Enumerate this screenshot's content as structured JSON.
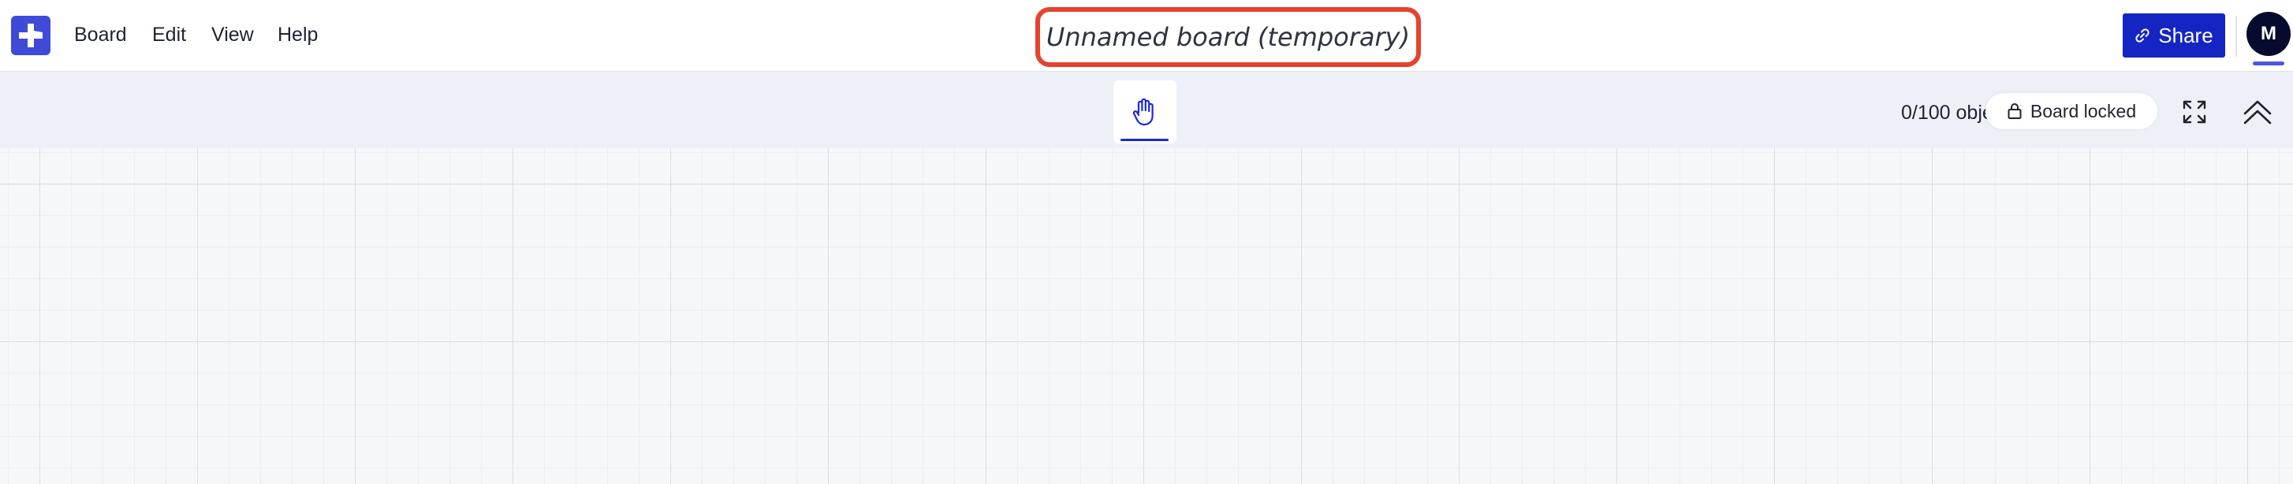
{
  "app": {
    "logo_icon": "plus-logo-icon",
    "brand_color": "#3f4bd8"
  },
  "menu": {
    "items": [
      {
        "label": "Board"
      },
      {
        "label": "Edit"
      },
      {
        "label": "View"
      },
      {
        "label": "Help"
      }
    ]
  },
  "board": {
    "title": "Unnamed board (temporary)",
    "highlight_color": "#e5432d"
  },
  "header": {
    "share_label": "Share",
    "share_icon": "link-icon",
    "share_color": "#1525c4",
    "avatar_initial": "M"
  },
  "toolbar": {
    "active_tool_icon": "hand-icon",
    "object_count": "0/100 objects",
    "board_locked_label": "Board locked",
    "lock_icon": "lock-icon",
    "fullscreen_icon": "fullscreen-icon",
    "collapse_icon": "chevron-double-up-icon"
  }
}
